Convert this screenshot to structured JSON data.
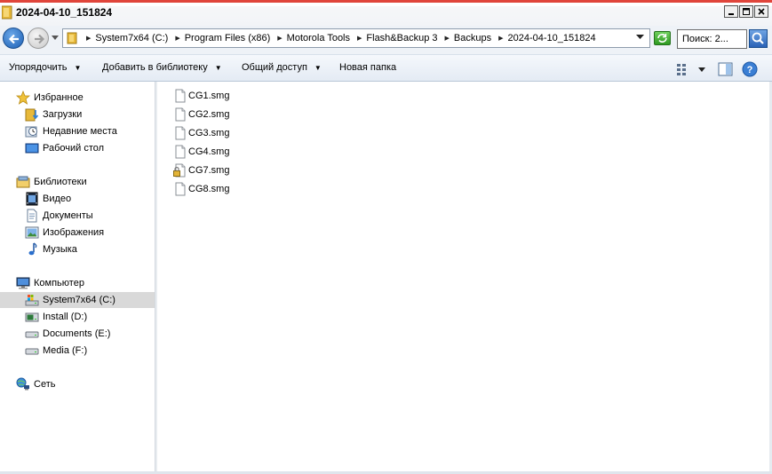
{
  "window": {
    "title": "2024-04-10_151824"
  },
  "address": {
    "crumbs": [
      "System7x64 (C:)",
      "Program Files (x86)",
      "Motorola Tools",
      "Flash&Backup 3",
      "Backups",
      "2024-04-10_151824"
    ],
    "search_placeholder": "Поиск: 2..."
  },
  "toolbar": {
    "organize": "Упорядочить",
    "add_library": "Добавить в библиотеку",
    "share": "Общий доступ",
    "new_folder": "Новая папка"
  },
  "nav": {
    "favorites": "Избранное",
    "downloads": "Загрузки",
    "recent": "Недавние места",
    "desktop": "Рабочий стол",
    "libraries": "Библиотеки",
    "video": "Видео",
    "documents": "Документы",
    "pictures": "Изображения",
    "music": "Музыка",
    "computer": "Компьютер",
    "drive_c": "System7x64 (C:)",
    "drive_d": "Install (D:)",
    "drive_e": "Documents (E:)",
    "drive_f": "Media (F:)",
    "network": "Сеть"
  },
  "files": [
    {
      "name": "CG1.smg",
      "locked": false
    },
    {
      "name": "CG2.smg",
      "locked": false
    },
    {
      "name": "CG3.smg",
      "locked": false
    },
    {
      "name": "CG4.smg",
      "locked": false
    },
    {
      "name": "CG7.smg",
      "locked": true
    },
    {
      "name": "CG8.smg",
      "locked": false
    }
  ],
  "colors": {
    "selected_bg": "#d9d9d9",
    "accent_top": "#e0453b"
  }
}
